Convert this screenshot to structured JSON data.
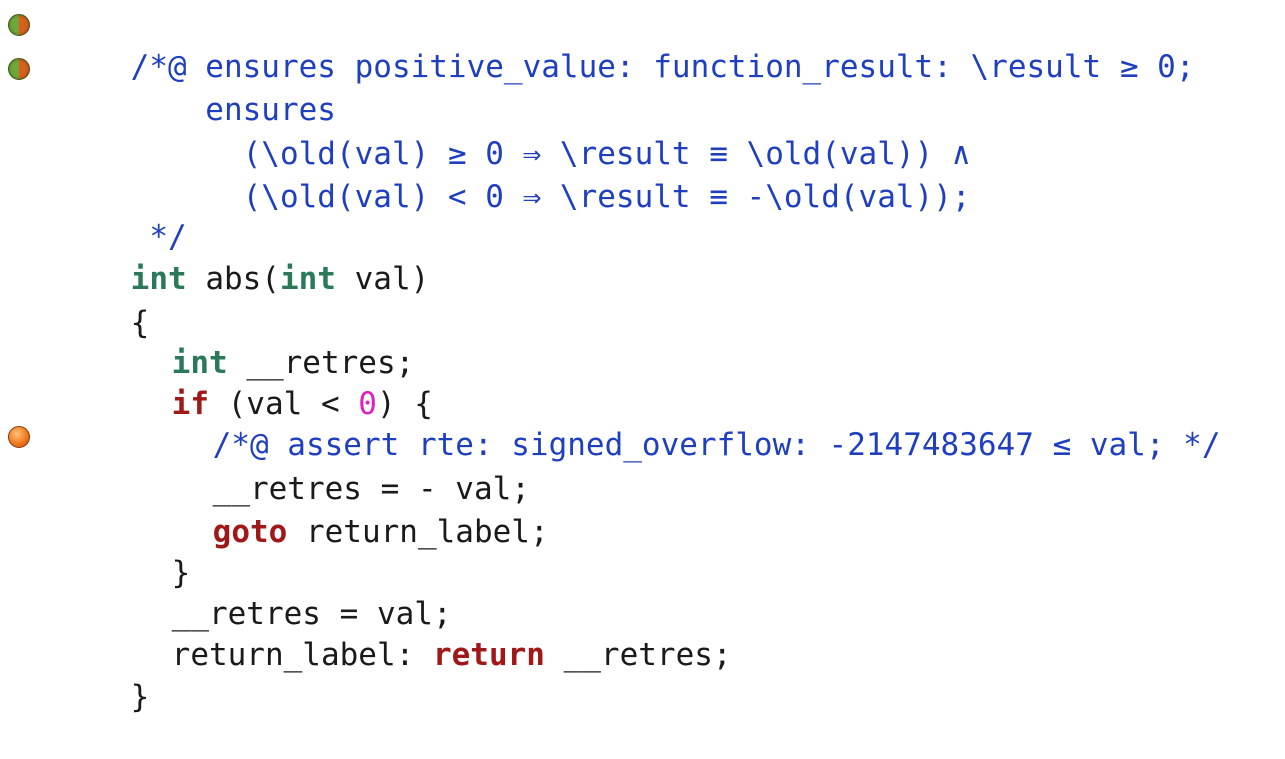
{
  "gutter": {
    "markers": [
      {
        "status": "partially-valid",
        "color_left": "#6fa83a",
        "color_right": "#d9601c"
      },
      {
        "status": "partially-valid",
        "color_left": "#6fa83a",
        "color_right": "#d9601c"
      },
      {
        "status": "unknown",
        "color": "#f07a1e"
      }
    ]
  },
  "colors": {
    "annotation": "#1f3fbf",
    "type_keyword": "#2a7a5a",
    "control_keyword": "#a01818",
    "number": "#e020c0",
    "plain": "#1a1a1a"
  },
  "code": {
    "l1": "/*@ ensures positive_value: function_result: \\result ≥ 0;",
    "l2": "    ensures",
    "l3": "      (\\old(val) ≥ 0 ⇒ \\result ≡ \\old(val)) ∧",
    "l4": "      (\\old(val) < 0 ⇒ \\result ≡ -\\old(val));",
    "l5": " */",
    "l6_kw1": "int",
    "l6_mid": " abs(",
    "l6_kw2": "int",
    "l6_end": " val)",
    "l7": "{",
    "l8_kw": "int",
    "l8_rest": " __retres;",
    "l9_kw": "if",
    "l9_mid": " (val < ",
    "l9_num": "0",
    "l9_end": ") {",
    "l10": "/*@ assert rte: signed_overflow: -2147483647 ≤ val; */",
    "l11": "__retres = - val;",
    "l12_kw": "goto",
    "l12_rest": " return_label;",
    "l13": "}",
    "l14": "__retres = val;",
    "l15_label": "return_label: ",
    "l15_kw": "return",
    "l15_rest": " __retres;",
    "l16": "}"
  }
}
